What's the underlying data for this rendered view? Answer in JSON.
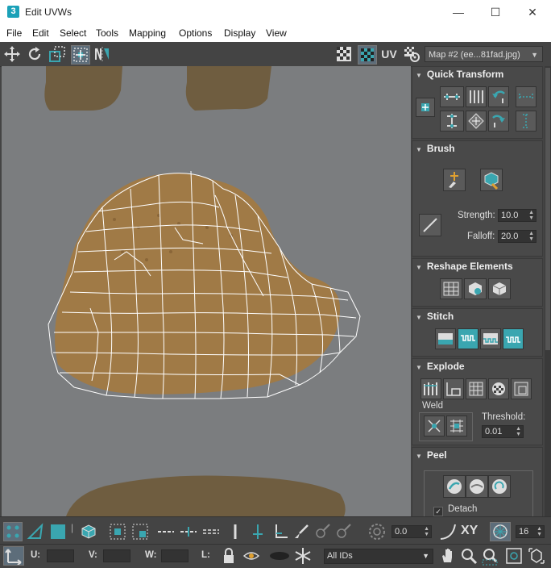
{
  "window": {
    "app_icon": "3",
    "title": "Edit UVWs",
    "minimize": "—",
    "maximize": "☐",
    "close": "✕"
  },
  "menu": [
    "File",
    "Edit",
    "Select",
    "Tools",
    "Mapping",
    "Options",
    "Display",
    "View"
  ],
  "toolbar": {
    "uv_label": "UV",
    "map_select": "Map #2 (ee...81fad.jpg)"
  },
  "panel": {
    "quick_transform": {
      "title": "Quick Transform"
    },
    "brush": {
      "title": "Brush",
      "strength_label": "Strength:",
      "strength": "10.0",
      "falloff_label": "Falloff:",
      "falloff": "20.0"
    },
    "reshape": {
      "title": "Reshape Elements"
    },
    "stitch": {
      "title": "Stitch"
    },
    "explode": {
      "title": "Explode",
      "weld_label": "Weld",
      "threshold_label": "Threshold:",
      "threshold": "0.01"
    },
    "peel": {
      "title": "Peel",
      "detach_label": "Detach",
      "detach_checked": true
    }
  },
  "bottom": {
    "rotate_value": "0.0",
    "xy_label": "XY",
    "grid_value": "16",
    "u_label": "U:",
    "v_label": "V:",
    "w_label": "W:",
    "l_label": "L:",
    "ids_select": "All IDs"
  },
  "colors": {
    "accent": "#3aa6b0",
    "panel_bg": "#444444",
    "viewport_bg": "#7b7d7f"
  }
}
